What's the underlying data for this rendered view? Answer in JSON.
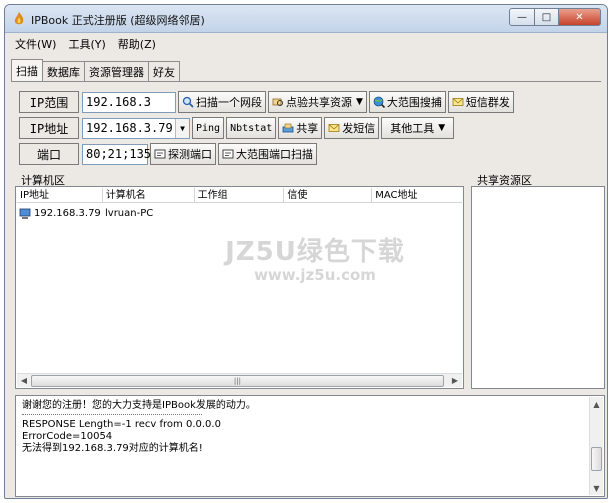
{
  "window": {
    "title": "IPBook 正式注册版 (超级网络邻居)",
    "controls": {
      "minimize": "—",
      "maximize": "□",
      "close": "✕"
    }
  },
  "menu": [
    "文件(W)",
    "工具(Y)",
    "帮助(Z)"
  ],
  "tabs": [
    "扫描",
    "数据库",
    "资源管理器",
    "好友"
  ],
  "active_tab": "扫描",
  "row_ip_range": {
    "label": "IP范围",
    "value": "192.168.3",
    "buttons": {
      "scan_segment": "扫描一个网段",
      "check_share": "点验共享资源",
      "wide_sniff": "大范围搜捕",
      "sms_group": "短信群发"
    }
  },
  "row_ip_addr": {
    "label": "IP地址",
    "value": "192.168.3.79",
    "buttons": {
      "ping": "Ping",
      "nbtstat": "Nbtstat",
      "share": "共享",
      "send_sms": "发短信",
      "other_tools": "其他工具"
    }
  },
  "row_port": {
    "label": "端口",
    "value": "80;21;135",
    "buttons": {
      "probe_port": "探测端口",
      "wide_port_scan": "大范围端口扫描"
    }
  },
  "computer_area": {
    "label": "计算机区",
    "columns": [
      "IP地址",
      "计算机名",
      "工作组",
      "信使",
      "MAC地址"
    ],
    "rows": [
      {
        "ip": "192.168.3.79",
        "name": "lvruan-PC",
        "workgroup": "",
        "messenger": "",
        "mac": ""
      }
    ]
  },
  "share_area": {
    "label": "共享资源区"
  },
  "log": {
    "first": "谢谢您的注册！您的大力支持是IPBook发展的动力。",
    "lines": [
      "RESPONSE Length=-1 recv from 0.0.0.0",
      " ErrorCode=10054",
      "无法得到192.168.3.79对应的计算机名!"
    ]
  },
  "watermark": {
    "main": "JZ5U绿色下载",
    "url": "www.jz5u.com"
  },
  "colors": {
    "window_bg": "#ece9e4",
    "titlebar": "#c3d3e8",
    "close": "#c8432b",
    "field_border": "#7f9db9"
  }
}
